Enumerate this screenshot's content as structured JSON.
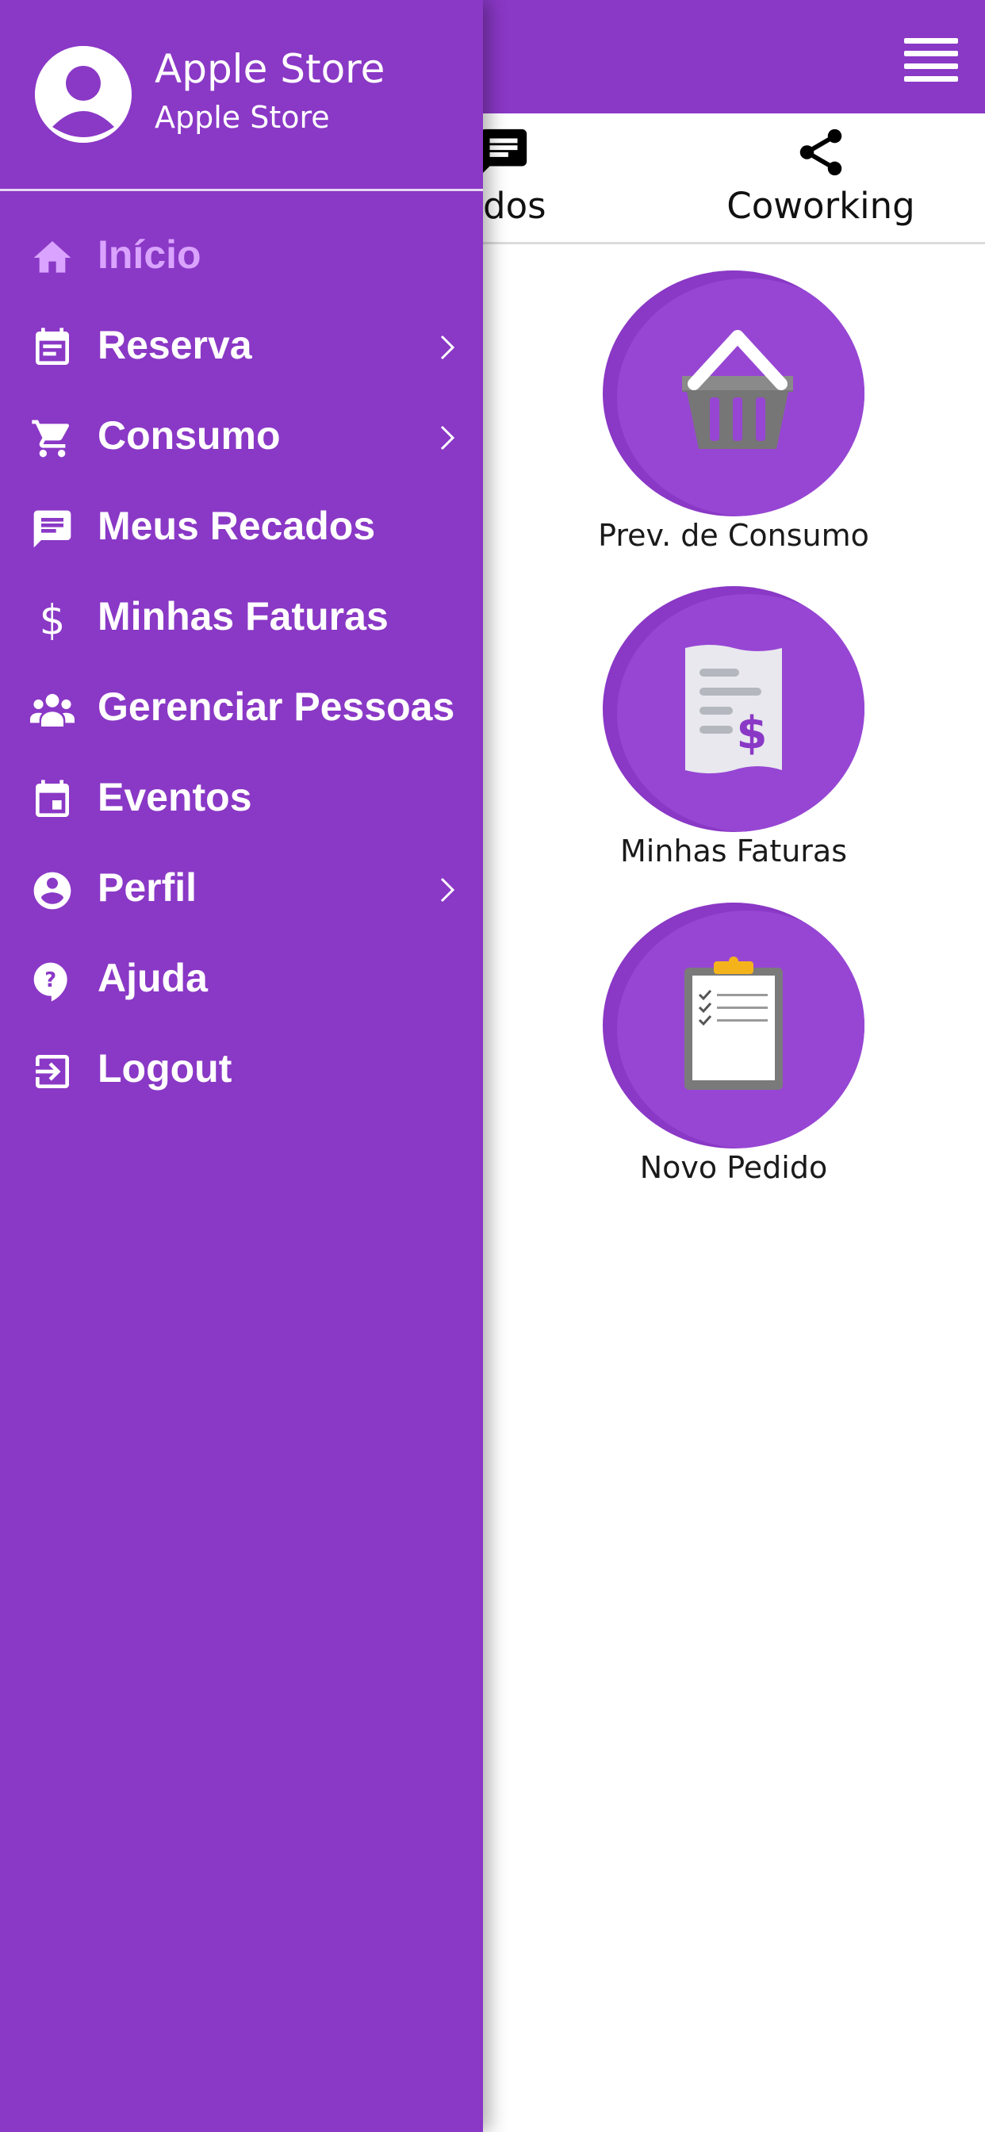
{
  "drawer": {
    "user_name": "Apple Store",
    "user_subtitle": "Apple Store",
    "avatar_icon": "user-circle-icon",
    "items": [
      {
        "label": "Início",
        "icon": "home-icon",
        "active": true,
        "has_submenu": false
      },
      {
        "label": "Reserva",
        "icon": "calendar-list-icon",
        "active": false,
        "has_submenu": true
      },
      {
        "label": "Consumo",
        "icon": "cart-icon",
        "active": false,
        "has_submenu": true
      },
      {
        "label": "Meus Recados",
        "icon": "message-icon",
        "active": false,
        "has_submenu": false
      },
      {
        "label": "Minhas Faturas",
        "icon": "dollar-icon",
        "active": false,
        "has_submenu": false
      },
      {
        "label": "Gerenciar Pessoas",
        "icon": "people-icon",
        "active": false,
        "has_submenu": false
      },
      {
        "label": "Eventos",
        "icon": "event-icon",
        "active": false,
        "has_submenu": false
      },
      {
        "label": "Perfil",
        "icon": "account-circle-icon",
        "active": false,
        "has_submenu": true
      },
      {
        "label": "Ajuda",
        "icon": "help-icon",
        "active": false,
        "has_submenu": false
      },
      {
        "label": "Logout",
        "icon": "logout-icon",
        "active": false,
        "has_submenu": false
      }
    ]
  },
  "header": {
    "menu_icon": "hamburger-menu-icon"
  },
  "tabs": [
    {
      "label": "ados",
      "icon": "message-icon"
    },
    {
      "label": "Coworking",
      "icon": "share-icon"
    }
  ],
  "tiles": [
    {
      "label": "Prev. de Consumo",
      "icon": "basket-icon"
    },
    {
      "label": "Minhas Faturas",
      "icon": "receipt-icon"
    },
    {
      "label": "Novo Pedido",
      "icon": "clipboard-icon"
    }
  ],
  "colors": {
    "primary": "#8a38c6",
    "active_item": "#d9a3ff",
    "text_on_primary": "#ffffff"
  }
}
